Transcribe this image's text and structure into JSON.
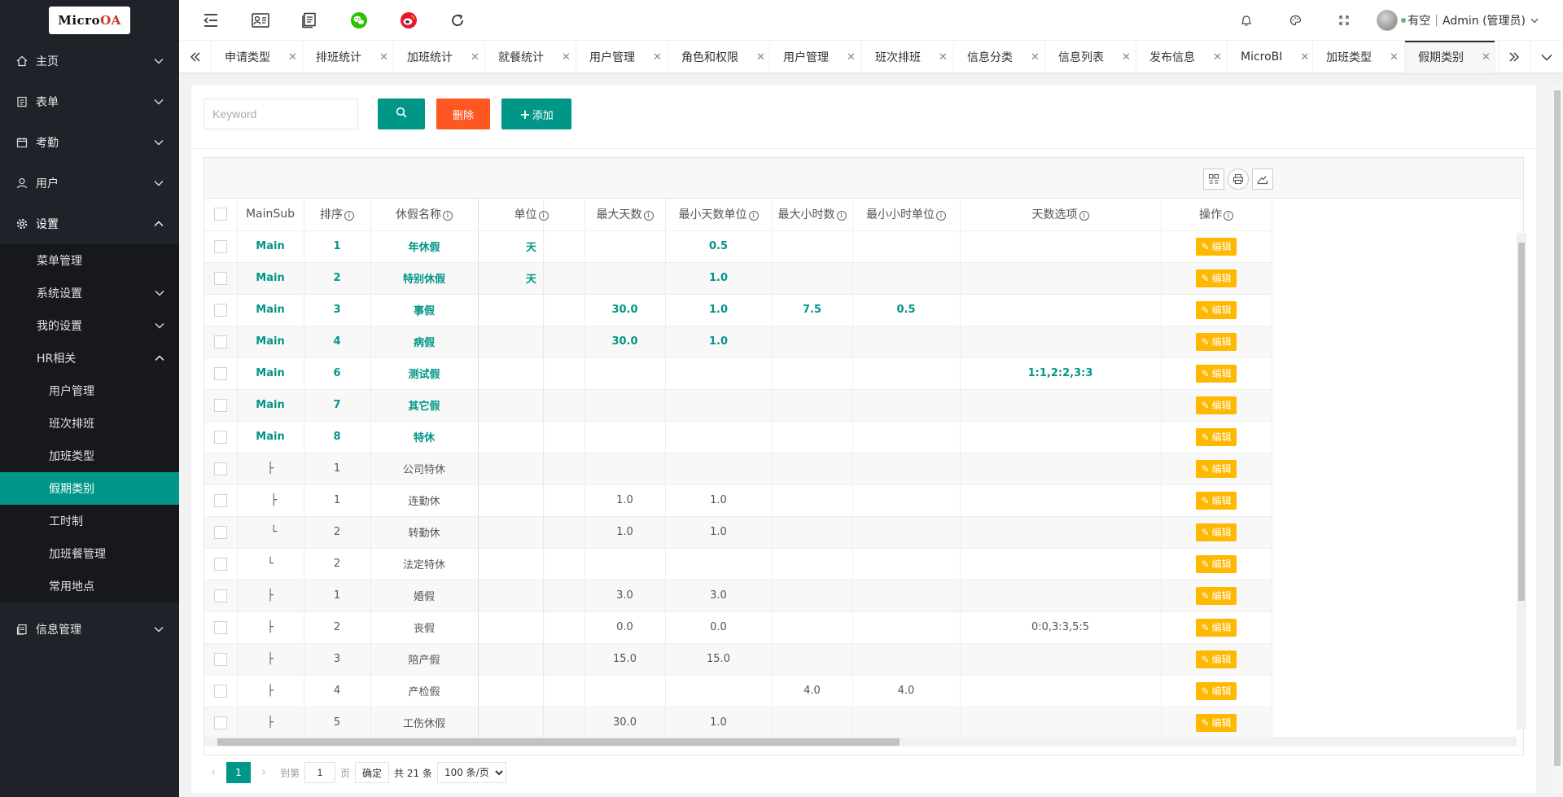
{
  "app": {
    "logo_text_pre": "Micro",
    "logo_text_accent": "OA"
  },
  "sidebar": {
    "items": [
      {
        "label": "主页",
        "icon": "home-icon"
      },
      {
        "label": "表单",
        "icon": "form-icon"
      },
      {
        "label": "考勤",
        "icon": "calendar-icon"
      },
      {
        "label": "用户",
        "icon": "user-icon"
      },
      {
        "label": "设置",
        "icon": "gear-icon"
      }
    ],
    "settings_sub": [
      {
        "label": "菜单管理"
      },
      {
        "label": "系统设置"
      },
      {
        "label": "我的设置"
      },
      {
        "label": "HR相关"
      }
    ],
    "hr_sub": [
      {
        "label": "用户管理"
      },
      {
        "label": "班次排班"
      },
      {
        "label": "加班类型"
      },
      {
        "label": "假期类别"
      },
      {
        "label": "工时制"
      },
      {
        "label": "加班餐管理"
      },
      {
        "label": "常用地点"
      }
    ],
    "info_mgmt": {
      "label": "信息管理",
      "icon": "document-icon"
    }
  },
  "header": {
    "user_status": "有空",
    "user_name": "Admin (管理员)"
  },
  "tabs": [
    {
      "label": "申请类型"
    },
    {
      "label": "排班统计"
    },
    {
      "label": "加班统计"
    },
    {
      "label": "就餐统计"
    },
    {
      "label": "用户管理"
    },
    {
      "label": "角色和权限"
    },
    {
      "label": "用户管理"
    },
    {
      "label": "班次排班"
    },
    {
      "label": "信息分类"
    },
    {
      "label": "信息列表"
    },
    {
      "label": "发布信息"
    },
    {
      "label": "MicroBI"
    },
    {
      "label": "加班类型"
    },
    {
      "label": "假期类别"
    }
  ],
  "toolbar": {
    "keyword_placeholder": "Keyword",
    "delete_label": "删除",
    "add_label": "添加"
  },
  "table": {
    "columns": [
      "MainSub",
      "排序",
      "休假名称",
      "单位",
      "最大天数",
      "最小天数单位",
      "最大小时数",
      "最小小时单位",
      "天数选项",
      "操作"
    ],
    "edit_label": "编辑",
    "rows": [
      {
        "main": "Main",
        "sort": "1",
        "name": "年休假",
        "unit": "天",
        "maxd": "",
        "mind": "0.5",
        "maxh": "",
        "minh": "",
        "opts": "",
        "strong": true
      },
      {
        "main": "Main",
        "sort": "2",
        "name": "特别休假",
        "unit": "天",
        "maxd": "",
        "mind": "1.0",
        "maxh": "",
        "minh": "",
        "opts": "",
        "strong": true
      },
      {
        "main": "Main",
        "sort": "3",
        "name": "事假",
        "unit": "",
        "maxd": "30.0",
        "mind": "1.0",
        "maxh": "7.5",
        "minh": "0.5",
        "opts": "",
        "strong": true
      },
      {
        "main": "Main",
        "sort": "4",
        "name": "病假",
        "unit": "",
        "maxd": "30.0",
        "mind": "1.0",
        "maxh": "",
        "minh": "",
        "opts": "",
        "strong": true
      },
      {
        "main": "Main",
        "sort": "6",
        "name": "测试假",
        "unit": "",
        "maxd": "",
        "mind": "",
        "maxh": "",
        "minh": "",
        "opts": "1:1,2:2,3:3",
        "strong": true
      },
      {
        "main": "Main",
        "sort": "7",
        "name": "其它假",
        "unit": "",
        "maxd": "",
        "mind": "",
        "maxh": "",
        "minh": "",
        "opts": "",
        "strong": true
      },
      {
        "main": "Main",
        "sort": "8",
        "name": "特休",
        "unit": "",
        "maxd": "",
        "mind": "",
        "maxh": "",
        "minh": "",
        "opts": "",
        "strong": true
      },
      {
        "main": "├",
        "sort": "1",
        "name": "公司特休",
        "unit": "",
        "maxd": "",
        "mind": "",
        "maxh": "",
        "minh": "",
        "opts": "",
        "strong": false
      },
      {
        "main": "  ├",
        "sort": "1",
        "name": "连勤休",
        "unit": "",
        "maxd": "1.0",
        "mind": "1.0",
        "maxh": "",
        "minh": "",
        "opts": "",
        "strong": false
      },
      {
        "main": "  └",
        "sort": "2",
        "name": "转勤休",
        "unit": "",
        "maxd": "1.0",
        "mind": "1.0",
        "maxh": "",
        "minh": "",
        "opts": "",
        "strong": false
      },
      {
        "main": "└",
        "sort": "2",
        "name": "法定特休",
        "unit": "",
        "maxd": "",
        "mind": "",
        "maxh": "",
        "minh": "",
        "opts": "",
        "strong": false
      },
      {
        "main": "├",
        "sort": "1",
        "name": "婚假",
        "unit": "",
        "maxd": "3.0",
        "mind": "3.0",
        "maxh": "",
        "minh": "",
        "opts": "",
        "strong": false
      },
      {
        "main": "├",
        "sort": "2",
        "name": "丧假",
        "unit": "",
        "maxd": "0.0",
        "mind": "0.0",
        "maxh": "",
        "minh": "",
        "opts": "0:0,3:3,5:5",
        "strong": false
      },
      {
        "main": "├",
        "sort": "3",
        "name": "陪产假",
        "unit": "",
        "maxd": "15.0",
        "mind": "15.0",
        "maxh": "",
        "minh": "",
        "opts": "",
        "strong": false
      },
      {
        "main": "├",
        "sort": "4",
        "name": "产检假",
        "unit": "",
        "maxd": "",
        "mind": "",
        "maxh": "4.0",
        "minh": "4.0",
        "opts": "",
        "strong": false
      },
      {
        "main": "├",
        "sort": "5",
        "name": "工伤休假",
        "unit": "",
        "maxd": "30.0",
        "mind": "1.0",
        "maxh": "",
        "minh": "",
        "opts": "",
        "strong": false
      }
    ]
  },
  "pager": {
    "current": "1",
    "goto_label": "到第",
    "page_input": "1",
    "page_unit": "页",
    "ok_label": "确定",
    "total": "共 21 条",
    "page_size": "100 条/页"
  },
  "colors": {
    "accent": "#009688",
    "danger": "#ff5722",
    "warn": "#ffb800",
    "sidebar": "#20222a"
  }
}
